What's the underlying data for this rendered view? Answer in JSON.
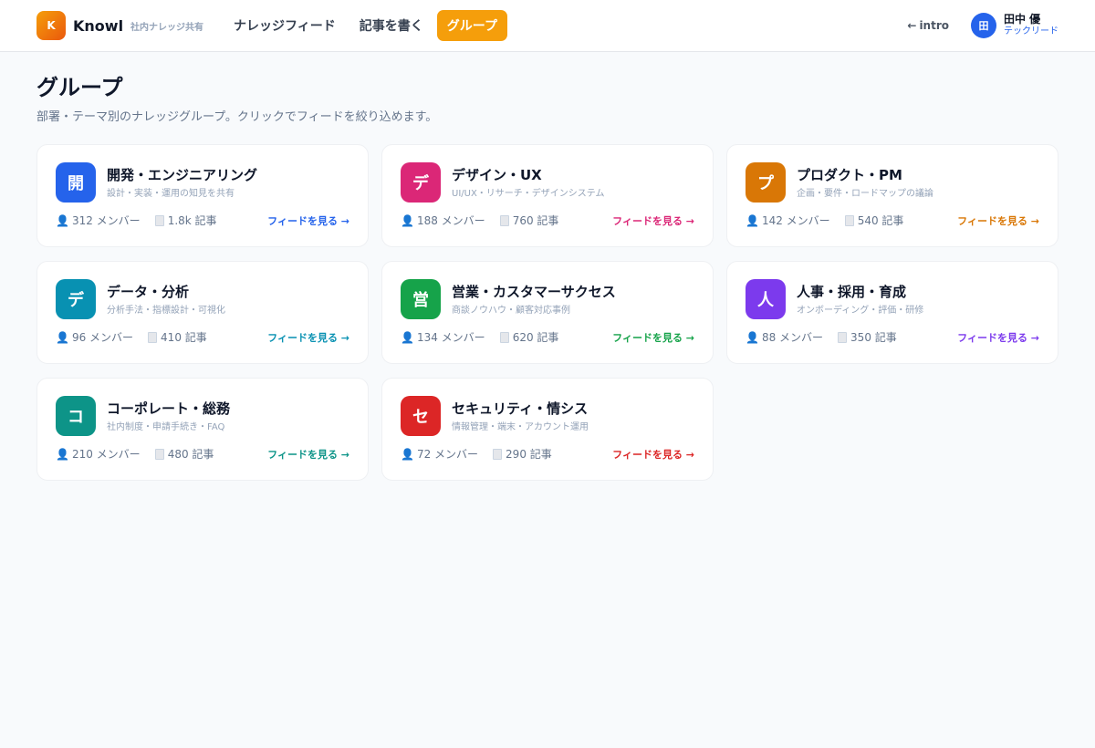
{
  "header": {
    "logo_letter": "K",
    "brand_name": "Knowl",
    "brand_tagline": "社内ナレッジ共有",
    "nav": [
      {
        "label": "ナレッジフィード",
        "active": false
      },
      {
        "label": "記事を書く",
        "active": false
      },
      {
        "label": "グループ",
        "active": true
      }
    ],
    "intro_label": "intro",
    "user": {
      "initial": "田",
      "name": "田中 優",
      "role": "テックリード"
    }
  },
  "page": {
    "title": "グループ",
    "subtitle": "部署・テーマ別のナレッジグループ。クリックでフィードを絞り込めます。"
  },
  "feed_link_label": "フィードを見る →",
  "groups": [
    {
      "initial": "開",
      "name": "開発・エンジニアリング",
      "desc": "設計・実装・運用の知見を共有",
      "members": "312 メンバー",
      "articles": "1.8k 記事",
      "color": "#2563eb"
    },
    {
      "initial": "デ",
      "name": "デザイン・UX",
      "desc": "UI/UX・リサーチ・デザインシステム",
      "members": "188 メンバー",
      "articles": "760 記事",
      "color": "#db2777"
    },
    {
      "initial": "プ",
      "name": "プロダクト・PM",
      "desc": "企画・要件・ロードマップの議論",
      "members": "142 メンバー",
      "articles": "540 記事",
      "color": "#d97706"
    },
    {
      "initial": "デ",
      "name": "データ・分析",
      "desc": "分析手法・指標設計・可視化",
      "members": "96 メンバー",
      "articles": "410 記事",
      "color": "#0891b2"
    },
    {
      "initial": "営",
      "name": "営業・カスタマーサクセス",
      "desc": "商談ノウハウ・顧客対応事例",
      "members": "134 メンバー",
      "articles": "620 記事",
      "color": "#16a34a"
    },
    {
      "initial": "人",
      "name": "人事・採用・育成",
      "desc": "オンボーディング・評価・研修",
      "members": "88 メンバー",
      "articles": "350 記事",
      "color": "#7c3aed"
    },
    {
      "initial": "コ",
      "name": "コーポレート・総務",
      "desc": "社内制度・申請手続き・FAQ",
      "members": "210 メンバー",
      "articles": "480 記事",
      "color": "#0d9488"
    },
    {
      "initial": "セ",
      "name": "セキュリティ・情シス",
      "desc": "情報管理・端末・アカウント運用",
      "members": "72 メンバー",
      "articles": "290 記事",
      "color": "#dc2626"
    }
  ]
}
